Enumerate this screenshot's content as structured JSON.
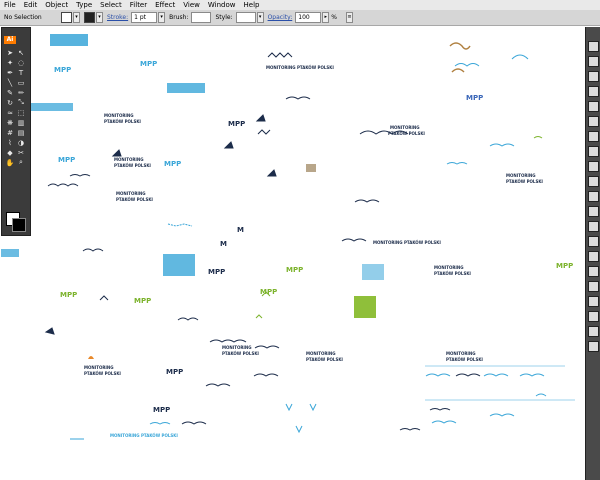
{
  "menu": [
    "File",
    "Edit",
    "Object",
    "Type",
    "Select",
    "Filter",
    "Effect",
    "View",
    "Window",
    "Help"
  ],
  "control_bar": {
    "selection": "No Selection",
    "stroke_label": "Stroke:",
    "stroke_weight": "1 pt",
    "brush_label": "Brush:",
    "style_label": "Style:",
    "opacity_label": "Opacity:",
    "opacity_value": "100",
    "percent": "%"
  },
  "tools_panel": {
    "badge": "Ai"
  },
  "icons": [
    "selection-tool",
    "direct-selection-tool",
    "magic-wand-tool",
    "lasso-tool",
    "pen-tool",
    "type-tool",
    "line-tool",
    "rectangle-tool",
    "paintbrush-tool",
    "pencil-tool",
    "rotate-tool",
    "scale-tool",
    "warp-tool",
    "free-transform-tool",
    "symbol-sprayer-tool",
    "graph-tool",
    "mesh-tool",
    "gradient-tool",
    "eyedropper-tool",
    "blend-tool",
    "live-paint-tool",
    "scissors-tool",
    "hand-tool",
    "zoom-tool"
  ],
  "colors": {
    "logo_blue": "#3aa6d8",
    "logo_navy": "#1c2c4a",
    "logo_green": "#7cb32c",
    "accent_orange": "#e8892b"
  },
  "artboard": {
    "mpp": "MPP",
    "tagline_1": "MONITORING",
    "tagline_2": "PTAKÓW POLSKI",
    "full_tagline": "MONITORING PTAKÓW POLSKI",
    "mmpp": "MPP",
    "m_letter": "M",
    "small_m": "M"
  }
}
